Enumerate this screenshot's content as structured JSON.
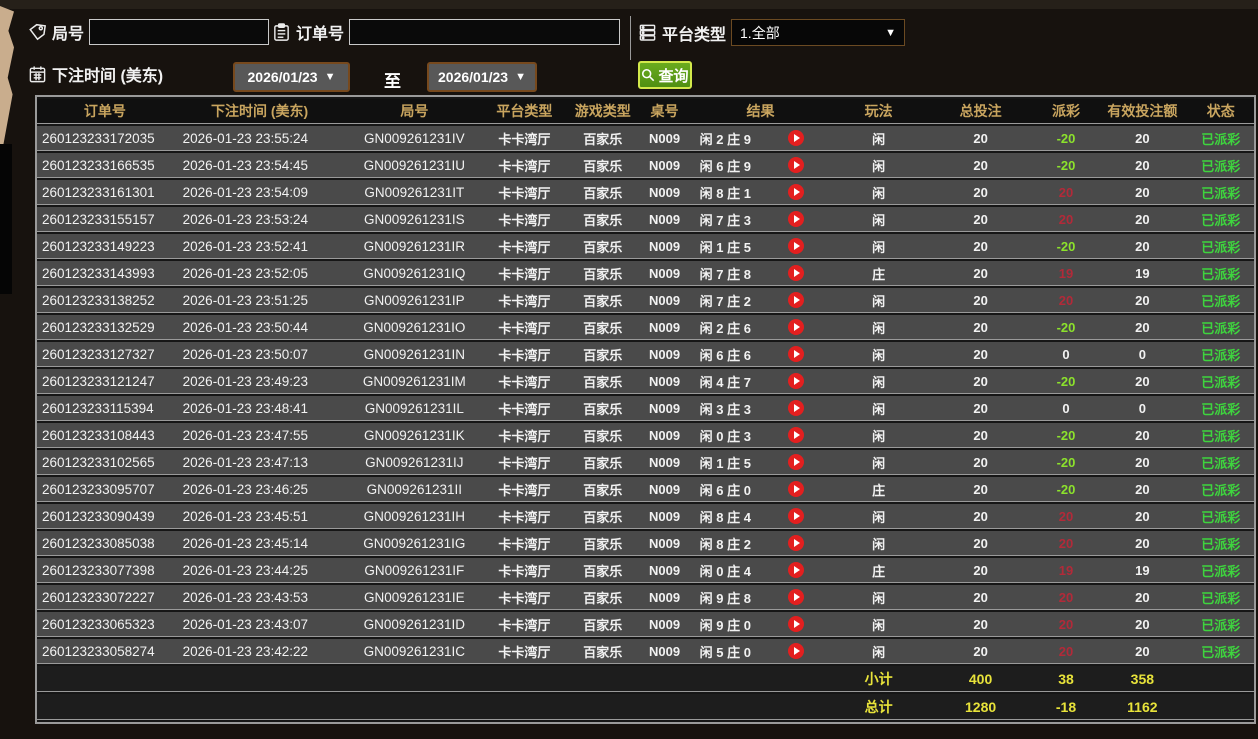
{
  "filters": {
    "round_label": "局号",
    "round_value": "",
    "order_label": "订单号",
    "order_value": "",
    "platform_label": "平台类型",
    "platform_value": "1.全部",
    "bet_time_label": "下注时间 (美东)",
    "date_from": "2026/01/23",
    "date_to": "2026/01/23",
    "to_label": "至",
    "search_label": "查询",
    "caret": "▼"
  },
  "icons": {
    "round": "tag-icon",
    "order": "clipboard-icon",
    "platform": "list-icon",
    "bet_time": "calendar-icon",
    "search": "magnifier-icon",
    "replay": "play-icon"
  },
  "colors": {
    "header_gold": "#c9a55f",
    "status_green": "#3ed43e",
    "payout_negative_green": "#8ce22c",
    "payout_positive_red": "#b22a39",
    "totals_yellow": "#e8e33a",
    "search_button_green": "#5f9c1b",
    "date_border_brown": "#77491d",
    "row_gray": "#4a4a4a"
  },
  "table": {
    "columns": [
      "订单号",
      "下注时间 (美东)",
      "局号",
      "平台类型",
      "游戏类型",
      "桌号",
      "结果",
      "玩法",
      "总投注",
      "派彩",
      "有效投注额",
      "状态"
    ],
    "rows": [
      {
        "order": "260123233172035",
        "time": "2026-01-23 23:55:24",
        "round": "GN009261231IV",
        "platform": "卡卡湾厅",
        "game": "百家乐",
        "table_no": "N009",
        "result": "闲 2 庄 9",
        "bet_type": "闲",
        "total_bet": "20",
        "payout": "-20",
        "payout_color": "neg",
        "valid_bet": "20",
        "status": "已派彩"
      },
      {
        "order": "260123233166535",
        "time": "2026-01-23 23:54:45",
        "round": "GN009261231IU",
        "platform": "卡卡湾厅",
        "game": "百家乐",
        "table_no": "N009",
        "result": "闲 6 庄 9",
        "bet_type": "闲",
        "total_bet": "20",
        "payout": "-20",
        "payout_color": "neg",
        "valid_bet": "20",
        "status": "已派彩"
      },
      {
        "order": "260123233161301",
        "time": "2026-01-23 23:54:09",
        "round": "GN009261231IT",
        "platform": "卡卡湾厅",
        "game": "百家乐",
        "table_no": "N009",
        "result": "闲 8 庄 1",
        "bet_type": "闲",
        "total_bet": "20",
        "payout": "20",
        "payout_color": "pos",
        "valid_bet": "20",
        "status": "已派彩"
      },
      {
        "order": "260123233155157",
        "time": "2026-01-23 23:53:24",
        "round": "GN009261231IS",
        "platform": "卡卡湾厅",
        "game": "百家乐",
        "table_no": "N009",
        "result": "闲 7 庄 3",
        "bet_type": "闲",
        "total_bet": "20",
        "payout": "20",
        "payout_color": "pos",
        "valid_bet": "20",
        "status": "已派彩"
      },
      {
        "order": "260123233149223",
        "time": "2026-01-23 23:52:41",
        "round": "GN009261231IR",
        "platform": "卡卡湾厅",
        "game": "百家乐",
        "table_no": "N009",
        "result": "闲 1 庄 5",
        "bet_type": "闲",
        "total_bet": "20",
        "payout": "-20",
        "payout_color": "neg",
        "valid_bet": "20",
        "status": "已派彩"
      },
      {
        "order": "260123233143993",
        "time": "2026-01-23 23:52:05",
        "round": "GN009261231IQ",
        "platform": "卡卡湾厅",
        "game": "百家乐",
        "table_no": "N009",
        "result": "闲 7 庄 8",
        "bet_type": "庄",
        "total_bet": "20",
        "payout": "19",
        "payout_color": "pos",
        "valid_bet": "19",
        "status": "已派彩"
      },
      {
        "order": "260123233138252",
        "time": "2026-01-23 23:51:25",
        "round": "GN009261231IP",
        "platform": "卡卡湾厅",
        "game": "百家乐",
        "table_no": "N009",
        "result": "闲 7 庄 2",
        "bet_type": "闲",
        "total_bet": "20",
        "payout": "20",
        "payout_color": "pos",
        "valid_bet": "20",
        "status": "已派彩"
      },
      {
        "order": "260123233132529",
        "time": "2026-01-23 23:50:44",
        "round": "GN009261231IO",
        "platform": "卡卡湾厅",
        "game": "百家乐",
        "table_no": "N009",
        "result": "闲 2 庄 6",
        "bet_type": "闲",
        "total_bet": "20",
        "payout": "-20",
        "payout_color": "neg",
        "valid_bet": "20",
        "status": "已派彩"
      },
      {
        "order": "260123233127327",
        "time": "2026-01-23 23:50:07",
        "round": "GN009261231IN",
        "platform": "卡卡湾厅",
        "game": "百家乐",
        "table_no": "N009",
        "result": "闲 6 庄 6",
        "bet_type": "闲",
        "total_bet": "20",
        "payout": "0",
        "payout_color": "zero",
        "valid_bet": "0",
        "status": "已派彩"
      },
      {
        "order": "260123233121247",
        "time": "2026-01-23 23:49:23",
        "round": "GN009261231IM",
        "platform": "卡卡湾厅",
        "game": "百家乐",
        "table_no": "N009",
        "result": "闲 4 庄 7",
        "bet_type": "闲",
        "total_bet": "20",
        "payout": "-20",
        "payout_color": "neg",
        "valid_bet": "20",
        "status": "已派彩"
      },
      {
        "order": "260123233115394",
        "time": "2026-01-23 23:48:41",
        "round": "GN009261231IL",
        "platform": "卡卡湾厅",
        "game": "百家乐",
        "table_no": "N009",
        "result": "闲 3 庄 3",
        "bet_type": "闲",
        "total_bet": "20",
        "payout": "0",
        "payout_color": "zero",
        "valid_bet": "0",
        "status": "已派彩"
      },
      {
        "order": "260123233108443",
        "time": "2026-01-23 23:47:55",
        "round": "GN009261231IK",
        "platform": "卡卡湾厅",
        "game": "百家乐",
        "table_no": "N009",
        "result": "闲 0 庄 3",
        "bet_type": "闲",
        "total_bet": "20",
        "payout": "-20",
        "payout_color": "neg",
        "valid_bet": "20",
        "status": "已派彩"
      },
      {
        "order": "260123233102565",
        "time": "2026-01-23 23:47:13",
        "round": "GN009261231IJ",
        "platform": "卡卡湾厅",
        "game": "百家乐",
        "table_no": "N009",
        "result": "闲 1 庄 5",
        "bet_type": "闲",
        "total_bet": "20",
        "payout": "-20",
        "payout_color": "neg",
        "valid_bet": "20",
        "status": "已派彩"
      },
      {
        "order": "260123233095707",
        "time": "2026-01-23 23:46:25",
        "round": "GN009261231II",
        "platform": "卡卡湾厅",
        "game": "百家乐",
        "table_no": "N009",
        "result": "闲 6 庄 0",
        "bet_type": "庄",
        "total_bet": "20",
        "payout": "-20",
        "payout_color": "neg",
        "valid_bet": "20",
        "status": "已派彩"
      },
      {
        "order": "260123233090439",
        "time": "2026-01-23 23:45:51",
        "round": "GN009261231IH",
        "platform": "卡卡湾厅",
        "game": "百家乐",
        "table_no": "N009",
        "result": "闲 8 庄 4",
        "bet_type": "闲",
        "total_bet": "20",
        "payout": "20",
        "payout_color": "pos",
        "valid_bet": "20",
        "status": "已派彩"
      },
      {
        "order": "260123233085038",
        "time": "2026-01-23 23:45:14",
        "round": "GN009261231IG",
        "platform": "卡卡湾厅",
        "game": "百家乐",
        "table_no": "N009",
        "result": "闲 8 庄 2",
        "bet_type": "闲",
        "total_bet": "20",
        "payout": "20",
        "payout_color": "pos",
        "valid_bet": "20",
        "status": "已派彩"
      },
      {
        "order": "260123233077398",
        "time": "2026-01-23 23:44:25",
        "round": "GN009261231IF",
        "platform": "卡卡湾厅",
        "game": "百家乐",
        "table_no": "N009",
        "result": "闲 0 庄 4",
        "bet_type": "庄",
        "total_bet": "20",
        "payout": "19",
        "payout_color": "pos",
        "valid_bet": "19",
        "status": "已派彩"
      },
      {
        "order": "260123233072227",
        "time": "2026-01-23 23:43:53",
        "round": "GN009261231IE",
        "platform": "卡卡湾厅",
        "game": "百家乐",
        "table_no": "N009",
        "result": "闲 9 庄 8",
        "bet_type": "闲",
        "total_bet": "20",
        "payout": "20",
        "payout_color": "pos",
        "valid_bet": "20",
        "status": "已派彩"
      },
      {
        "order": "260123233065323",
        "time": "2026-01-23 23:43:07",
        "round": "GN009261231ID",
        "platform": "卡卡湾厅",
        "game": "百家乐",
        "table_no": "N009",
        "result": "闲 9 庄 0",
        "bet_type": "闲",
        "total_bet": "20",
        "payout": "20",
        "payout_color": "pos",
        "valid_bet": "20",
        "status": "已派彩"
      },
      {
        "order": "260123233058274",
        "time": "2026-01-23 23:42:22",
        "round": "GN009261231IC",
        "platform": "卡卡湾厅",
        "game": "百家乐",
        "table_no": "N009",
        "result": "闲 5 庄 0",
        "bet_type": "闲",
        "total_bet": "20",
        "payout": "20",
        "payout_color": "pos",
        "valid_bet": "20",
        "status": "已派彩"
      }
    ],
    "subtotal": {
      "label": "小计",
      "total_bet": "400",
      "payout": "38",
      "valid_bet": "358"
    },
    "total": {
      "label": "总计",
      "total_bet": "1280",
      "payout": "-18",
      "valid_bet": "1162"
    }
  }
}
